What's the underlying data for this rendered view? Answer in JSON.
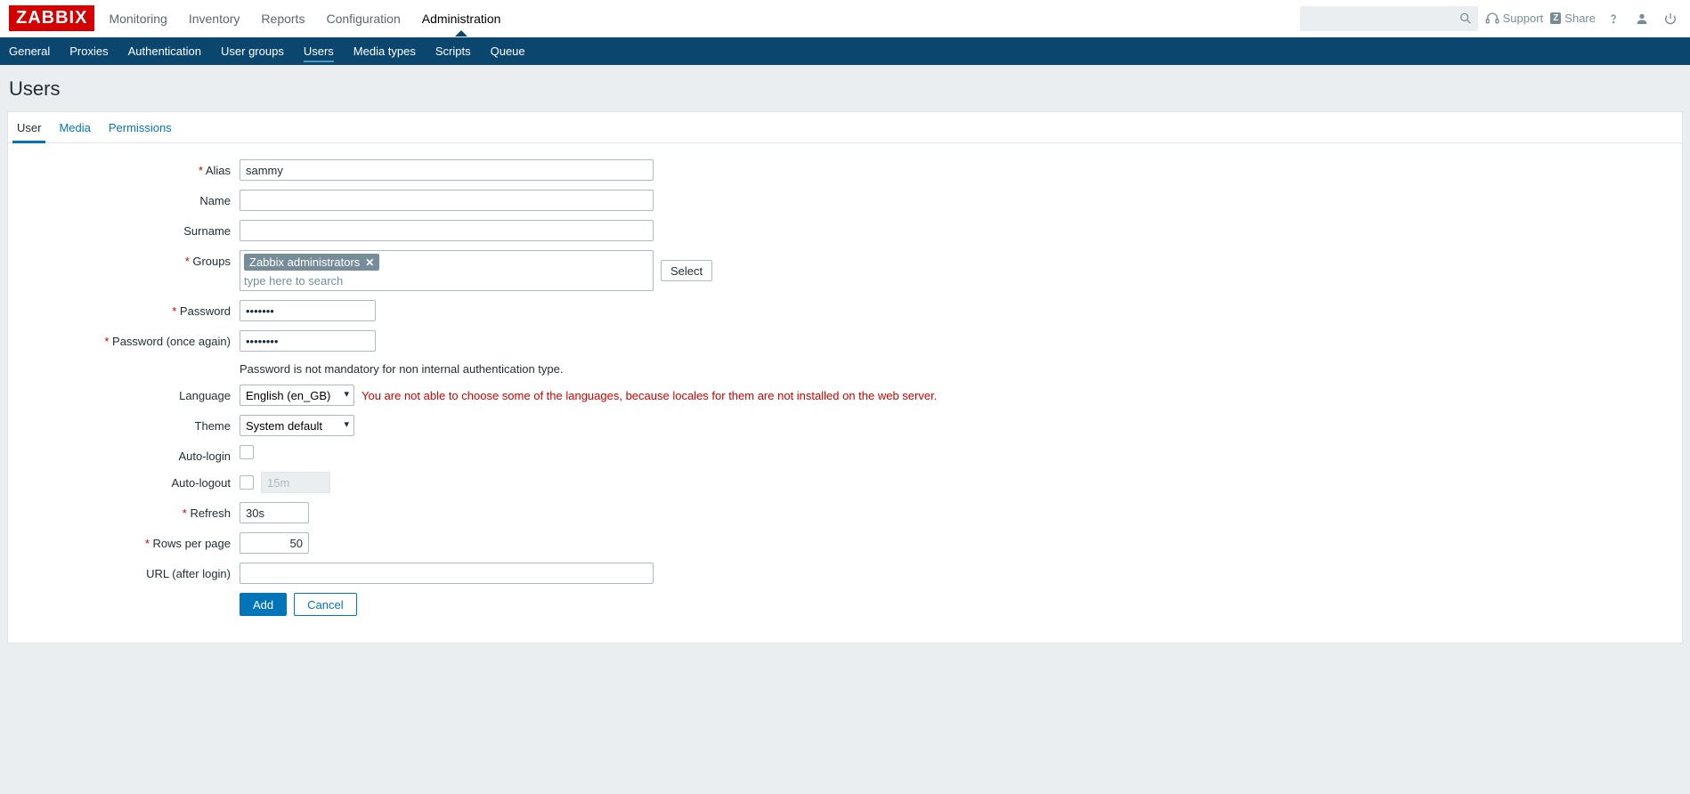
{
  "logo": "ZABBIX",
  "topNav": {
    "items": [
      "Monitoring",
      "Inventory",
      "Reports",
      "Configuration",
      "Administration"
    ],
    "activeIndex": 4
  },
  "topRight": {
    "searchPlaceholder": "",
    "support": "Support",
    "share": "Share"
  },
  "subNav": {
    "items": [
      "General",
      "Proxies",
      "Authentication",
      "User groups",
      "Users",
      "Media types",
      "Scripts",
      "Queue"
    ],
    "activeIndex": 4
  },
  "pageTitle": "Users",
  "tabs": {
    "items": [
      "User",
      "Media",
      "Permissions"
    ],
    "activeIndex": 0
  },
  "form": {
    "alias": {
      "label": "Alias",
      "value": "sammy"
    },
    "name": {
      "label": "Name",
      "value": ""
    },
    "surname": {
      "label": "Surname",
      "value": ""
    },
    "groups": {
      "label": "Groups",
      "tags": [
        "Zabbix administrators"
      ],
      "placeholder": "type here to search",
      "selectBtn": "Select"
    },
    "password": {
      "label": "Password",
      "value": "•••••••"
    },
    "password2": {
      "label": "Password (once again)",
      "value": "••••••••"
    },
    "passwordNote": "Password is not mandatory for non internal authentication type.",
    "language": {
      "label": "Language",
      "value": "English (en_GB)",
      "warning": "You are not able to choose some of the languages, because locales for them are not installed on the web server."
    },
    "theme": {
      "label": "Theme",
      "value": "System default"
    },
    "autoLogin": {
      "label": "Auto-login",
      "checked": false
    },
    "autoLogout": {
      "label": "Auto-logout",
      "checked": false,
      "value": "15m"
    },
    "refresh": {
      "label": "Refresh",
      "value": "30s"
    },
    "rowsPerPage": {
      "label": "Rows per page",
      "value": "50"
    },
    "urlAfterLogin": {
      "label": "URL (after login)",
      "value": ""
    },
    "addBtn": "Add",
    "cancelBtn": "Cancel"
  }
}
